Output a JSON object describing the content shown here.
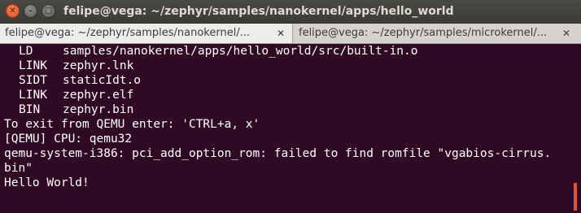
{
  "window": {
    "title": "felipe@vega: ~/zephyr/samples/nanokernel/apps/hello_world",
    "close_glyph": "✕",
    "minimize_glyph": "–",
    "maximize_glyph": "□"
  },
  "tabs": [
    {
      "label": "felipe@vega: ~/zephyr/samples/nanokernel/...",
      "close": "✕"
    },
    {
      "label": "felipe@vega: ~/zephyr/samples/microkernel/...",
      "close": "✕"
    }
  ],
  "terminal": {
    "build_lines": [
      {
        "cmd": "LD",
        "arg": "samples/nanokernel/apps/hello_world/src/built-in.o"
      },
      {
        "cmd": "LINK",
        "arg": "zephyr.lnk"
      },
      {
        "cmd": "SIDT",
        "arg": "staticIdt.o"
      },
      {
        "cmd": "LINK",
        "arg": "zephyr.elf"
      },
      {
        "cmd": "BIN",
        "arg": "zephyr.bin"
      }
    ],
    "output_lines": [
      "To exit from QEMU enter: 'CTRL+a, x'",
      "[QEMU] CPU: qemu32",
      "qemu-system-i386: pci_add_option_rom: failed to find romfile \"vgabios-cirrus.",
      "bin\"",
      "Hello World!"
    ]
  },
  "colors": {
    "terminal_bg": "#300a24",
    "text": "#ffffff",
    "accent": "#e95420"
  }
}
